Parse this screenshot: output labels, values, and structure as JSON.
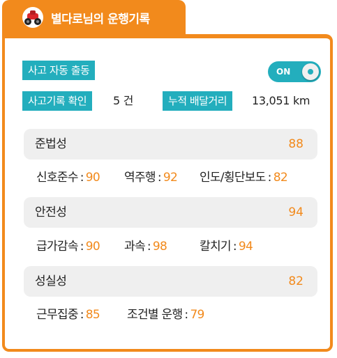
{
  "header": {
    "title": "별다로님의 운행기록",
    "icon": "motorcycle-icon"
  },
  "auto_dispatch": {
    "label": "사고 자동 출동",
    "toggle_text": "ON"
  },
  "accident_check": {
    "label": "사고기록 확인",
    "value": "5 건"
  },
  "distance": {
    "label": "누적 배달거리",
    "value": "13,051 km"
  },
  "sections": [
    {
      "name": "준법성",
      "score": "88",
      "metrics": [
        {
          "label": "신호준수",
          "value": "90"
        },
        {
          "label": "역주행",
          "value": "92"
        },
        {
          "label": "인도/횡단보도",
          "value": "82"
        }
      ]
    },
    {
      "name": "안전성",
      "score": "94",
      "metrics": [
        {
          "label": "급가감속",
          "value": "90"
        },
        {
          "label": "과속",
          "value": "98"
        },
        {
          "label": "칼치기",
          "value": "94"
        }
      ]
    },
    {
      "name": "성실성",
      "score": "82",
      "metrics": [
        {
          "label": "근무집중",
          "value": "85"
        },
        {
          "label": "조건별 운행",
          "value": "79"
        }
      ]
    }
  ],
  "colors": {
    "accent": "#f28a1c",
    "teal": "#23aebd",
    "bar_bg": "#efefef"
  }
}
